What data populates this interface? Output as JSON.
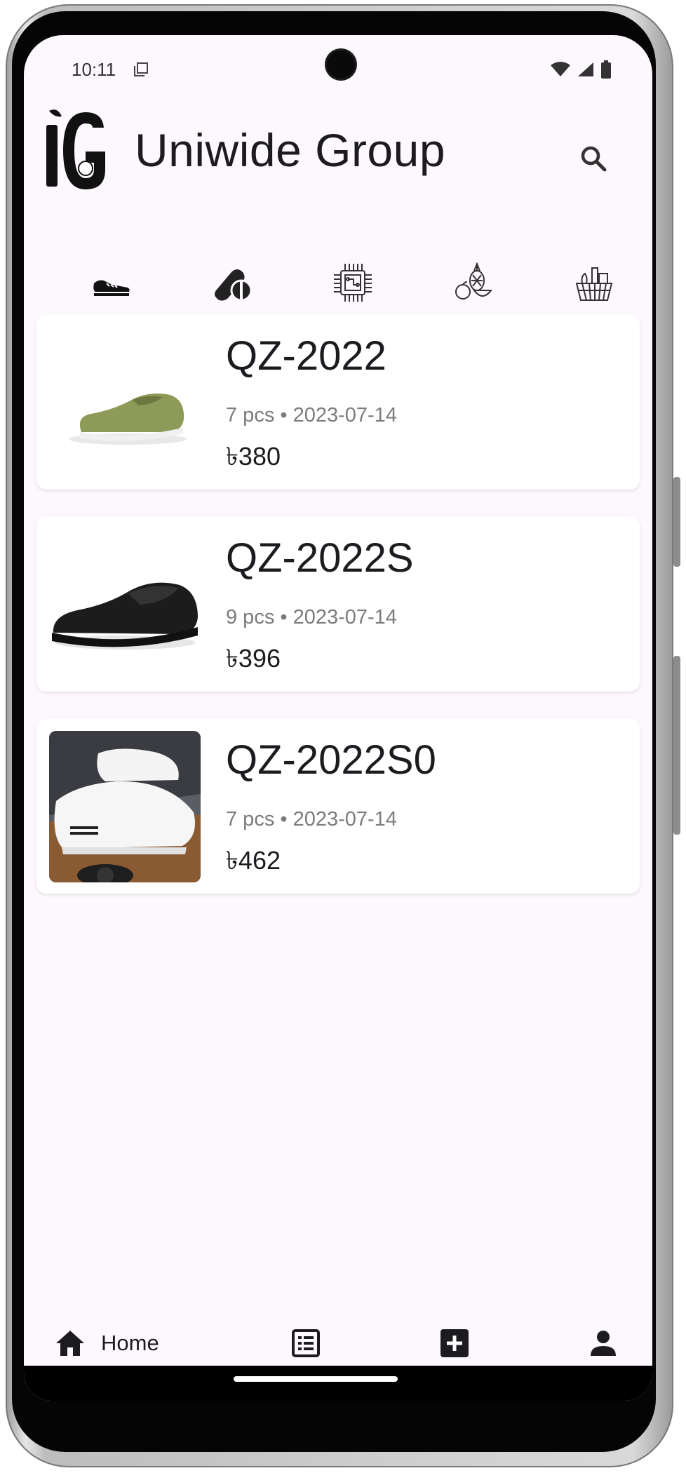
{
  "status_bar": {
    "time": "10:11"
  },
  "header": {
    "title": "Uniwide Group",
    "logo_text": "IG"
  },
  "tabs": [
    {
      "icon": "sneaker-icon",
      "selected": true
    },
    {
      "icon": "pills-icon",
      "selected": false
    },
    {
      "icon": "chip-icon",
      "selected": false
    },
    {
      "icon": "fruits-icon",
      "selected": false
    },
    {
      "icon": "grocery-basket-icon",
      "selected": false
    }
  ],
  "products": [
    {
      "name": "QZ-2022",
      "meta": "7 pcs • 2023-07-14",
      "price": "৳380",
      "image": "green-slip-on-shoe"
    },
    {
      "name": "QZ-2022S",
      "meta": "9 pcs • 2023-07-14",
      "price": "৳396",
      "image": "black-slip-on-shoe"
    },
    {
      "name": "QZ-2022S0",
      "meta": "7 pcs • 2023-07-14",
      "price": "৳462",
      "image": "white-sneakers-photo"
    }
  ],
  "bottom_nav": {
    "home_label": "Home",
    "items": [
      "home-icon",
      "list-icon",
      "add-box-icon",
      "person-icon"
    ]
  },
  "colors": {
    "accent": "#3b82f6",
    "background": "#fdf8fd",
    "text": "#1c1b1f",
    "muted": "#7b7b80"
  }
}
